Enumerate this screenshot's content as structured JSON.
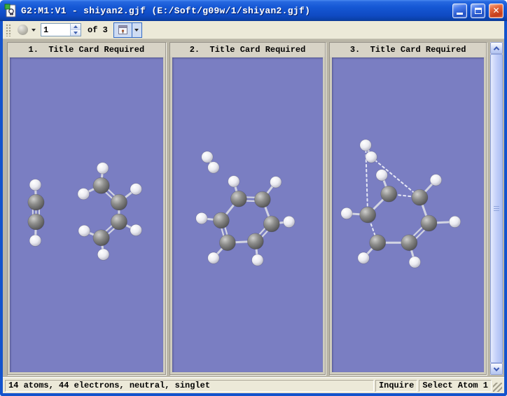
{
  "window": {
    "title": "G2:M1:V1 - shiyan2.gjf (E:/Soft/g09w/1/shiyan2.gjf)"
  },
  "icons": {
    "close": "✕",
    "app_icon": "gaussview-logo",
    "sphere_button": "element-sphere",
    "view_button": "molecule-window"
  },
  "toolbar": {
    "frame_value": "1",
    "of_label": "of 3"
  },
  "panels": [
    {
      "label": "1.  Title Card Required",
      "molecule": {
        "atoms": [
          [
            "H",
            36,
            183
          ],
          [
            "C",
            37,
            208
          ],
          [
            "C",
            37,
            236
          ],
          [
            "H",
            36,
            263
          ],
          [
            "H",
            131,
            159
          ],
          [
            "C",
            129,
            184
          ],
          [
            "H",
            104,
            196
          ],
          [
            "C",
            154,
            208
          ],
          [
            "H",
            178,
            189
          ],
          [
            "C",
            154,
            236
          ],
          [
            "H",
            178,
            248
          ],
          [
            "C",
            129,
            259
          ],
          [
            "H",
            105,
            249
          ],
          [
            "H",
            132,
            283
          ]
        ],
        "bonds": [
          [
            0,
            1,
            "single"
          ],
          [
            1,
            2,
            "triple"
          ],
          [
            2,
            3,
            "single"
          ],
          [
            4,
            5,
            "single"
          ],
          [
            5,
            6,
            "single"
          ],
          [
            5,
            7,
            "double"
          ],
          [
            7,
            8,
            "single"
          ],
          [
            7,
            9,
            "single"
          ],
          [
            9,
            10,
            "single"
          ],
          [
            9,
            11,
            "double"
          ],
          [
            11,
            12,
            "single"
          ],
          [
            11,
            13,
            "single"
          ]
        ]
      }
    },
    {
      "label": "2.  Title Card Required",
      "molecule": {
        "atoms": [
          [
            "H",
            50,
            143
          ],
          [
            "H",
            59,
            158
          ],
          [
            "C",
            95,
            203
          ],
          [
            "C",
            129,
            204
          ],
          [
            "C",
            70,
            234
          ],
          [
            "C",
            142,
            239
          ],
          [
            "C",
            79,
            266
          ],
          [
            "C",
            119,
            264
          ],
          [
            "H",
            88,
            178
          ],
          [
            "H",
            148,
            179
          ],
          [
            "H",
            42,
            231
          ],
          [
            "H",
            167,
            236
          ],
          [
            "H",
            59,
            288
          ],
          [
            "H",
            122,
            291
          ]
        ],
        "bonds": [
          [
            0,
            1,
            "single"
          ],
          [
            2,
            3,
            "double"
          ],
          [
            3,
            5,
            "single"
          ],
          [
            5,
            7,
            "double"
          ],
          [
            7,
            6,
            "single"
          ],
          [
            6,
            4,
            "double"
          ],
          [
            4,
            2,
            "single"
          ],
          [
            2,
            8,
            "single"
          ],
          [
            3,
            9,
            "single"
          ],
          [
            4,
            10,
            "single"
          ],
          [
            5,
            11,
            "single"
          ],
          [
            6,
            12,
            "single"
          ],
          [
            7,
            13,
            "single"
          ]
        ]
      }
    },
    {
      "label": "3.  Title Card Required",
      "molecule": {
        "atoms": [
          [
            "H",
            48,
            126
          ],
          [
            "H",
            56,
            143
          ],
          [
            "C",
            81,
            196
          ],
          [
            "C",
            125,
            201
          ],
          [
            "C",
            51,
            226
          ],
          [
            "C",
            138,
            238
          ],
          [
            "C",
            65,
            266
          ],
          [
            "C",
            110,
            266
          ],
          [
            "H",
            71,
            169
          ],
          [
            "H",
            148,
            176
          ],
          [
            "H",
            21,
            224
          ],
          [
            "H",
            175,
            236
          ],
          [
            "H",
            45,
            288
          ],
          [
            "H",
            118,
            294
          ]
        ],
        "bonds": [
          [
            0,
            1,
            "single"
          ],
          [
            2,
            4,
            "single"
          ],
          [
            3,
            5,
            "single"
          ],
          [
            5,
            7,
            "double"
          ],
          [
            7,
            6,
            "single"
          ],
          [
            2,
            3,
            "dashed"
          ],
          [
            4,
            6,
            "dashed"
          ],
          [
            0,
            4,
            "dashed"
          ],
          [
            1,
            3,
            "dashed"
          ],
          [
            2,
            8,
            "single"
          ],
          [
            3,
            9,
            "single"
          ],
          [
            4,
            10,
            "single"
          ],
          [
            5,
            11,
            "single"
          ],
          [
            6,
            12,
            "single"
          ],
          [
            7,
            13,
            "single"
          ]
        ]
      }
    }
  ],
  "statusbar": {
    "message": "14 atoms, 44 electrons, neutral, singlet",
    "inquire": "Inquire",
    "select_atom": "Select Atom 1"
  },
  "colors": {
    "titlebar_blue": "#1557d4",
    "window_border": "#1353cc",
    "toolbar_bg": "#ece9d8",
    "client_bg": "#bab6a7",
    "panel_header_bg": "#d7d3c6",
    "viewport_bg": "#7a7ec2",
    "carbon_atom": "#8d8d8d",
    "hydrogen_atom": "#f2f2f6",
    "bond": "#d2d4e2",
    "close_button_red": "#d9572e"
  }
}
